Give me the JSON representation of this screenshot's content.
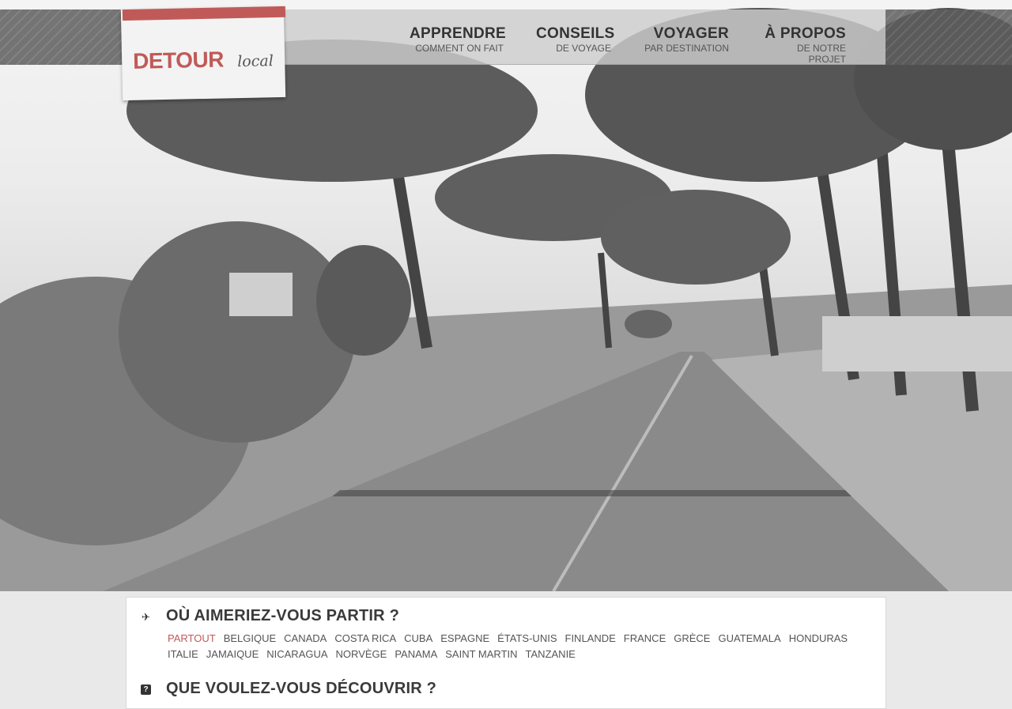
{
  "brand": {
    "name": "DETOUR",
    "suffix": "local",
    "accent_color": "#c05a58"
  },
  "nav": [
    {
      "title": "APPRENDRE",
      "subtitle": "COMMENT ON FAIT"
    },
    {
      "title": "CONSEILS",
      "subtitle": "DE VOYAGE"
    },
    {
      "title": "VOYAGER",
      "subtitle": "PAR DESTINATION"
    },
    {
      "title": "À PROPOS",
      "subtitle": "DE NOTRE PROJET"
    }
  ],
  "destinations": {
    "icon": "airplane-icon",
    "title": "OÙ AIMERIEZ-VOUS PARTIR ?",
    "items": [
      "PARTOUT",
      "BELGIQUE",
      "CANADA",
      "COSTA RICA",
      "CUBA",
      "ESPAGNE",
      "ÉTATS-UNIS",
      "FINLANDE",
      "FRANCE",
      "GRÈCE",
      "GUATEMALA",
      "HONDURAS",
      "ITALIE",
      "JAMAIQUE",
      "NICARAGUA",
      "NORVÈGE",
      "PANAMA",
      "SAINT MARTIN",
      "TANZANIE"
    ],
    "selected": "PARTOUT"
  },
  "discover": {
    "icon": "question-icon",
    "title": "QUE VOULEZ-VOUS DÉCOUVRIR ?"
  }
}
